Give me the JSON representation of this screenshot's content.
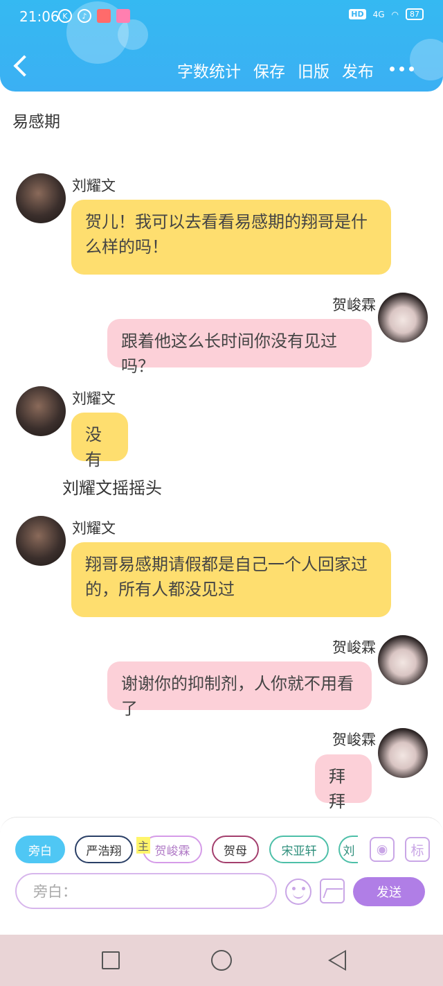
{
  "status_bar": {
    "time": "21:06",
    "network": "4G",
    "hd": "HD",
    "battery": "87"
  },
  "nav": {
    "actions": [
      "字数统计",
      "保存",
      "旧版",
      "发布"
    ]
  },
  "doc_title": "易感期",
  "messages": [
    {
      "name": "刘耀文",
      "text": "贺儿！我可以去看看易感期的翔哥是什么样的吗！"
    },
    {
      "name": "贺峻霖",
      "text": "跟着他这么长时间你没有见过吗？"
    },
    {
      "name": "刘耀文",
      "text": "没有"
    },
    {
      "name": "刘耀文",
      "text": "翔哥易感期请假都是自己一个人回家过的，所有人都没见过"
    },
    {
      "name": "贺峻霖",
      "text": "谢谢你的抑制剂，人你就不用看了"
    },
    {
      "name": "贺峻霖",
      "text": "拜拜"
    }
  ],
  "narration": "刘耀文摇摇头",
  "characters": [
    "旁白",
    "严浩翔",
    "贺峻霖",
    "贺母",
    "宋亚轩",
    "刘"
  ],
  "main_tag": "主",
  "tools": {
    "profile_icon": "person-card-icon",
    "tag_label": "标"
  },
  "input": {
    "placeholder": "旁白："
  },
  "send_label": "发送",
  "colors": {
    "header": "#3bb0f3",
    "left_bubble": "#fede6f",
    "right_bubble": "#fcd0d8",
    "send": "#b07ee6",
    "active_chip": "#4fc7f4"
  }
}
